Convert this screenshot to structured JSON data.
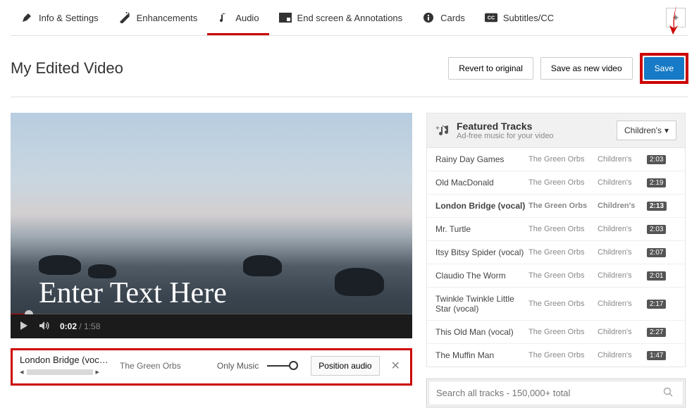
{
  "tabs": {
    "info": "Info & Settings",
    "enh": "Enhancements",
    "audio": "Audio",
    "endscreen": "End screen & Annotations",
    "cards": "Cards",
    "subs": "Subtitles/CC"
  },
  "header": {
    "title": "My Edited Video",
    "revert": "Revert to original",
    "save_new": "Save as new video",
    "save": "Save"
  },
  "video": {
    "overlay_text": "Enter Text Here",
    "time_current": "0:02",
    "time_total": "1:58"
  },
  "selected_track": {
    "title": "London Bridge (voc…",
    "artist": "The Green Orbs",
    "only_label": "Only Music",
    "position_btn": "Position audio"
  },
  "featured": {
    "title": "Featured Tracks",
    "sub": "Ad-free music for your video",
    "genre_selected": "Children's"
  },
  "tracks": [
    {
      "name": "Rainy Day Games",
      "artist": "The Green Orbs",
      "genre": "Children's",
      "dur": "2:03"
    },
    {
      "name": "Old MacDonald",
      "artist": "The Green Orbs",
      "genre": "Children's",
      "dur": "2:19"
    },
    {
      "name": "London Bridge (vocal)",
      "artist": "The Green Orbs",
      "genre": "Children's",
      "dur": "2:13"
    },
    {
      "name": "Mr. Turtle",
      "artist": "The Green Orbs",
      "genre": "Children's",
      "dur": "2:03"
    },
    {
      "name": "Itsy Bitsy Spider (vocal)",
      "artist": "The Green Orbs",
      "genre": "Children's",
      "dur": "2:07"
    },
    {
      "name": "Claudio The Worm",
      "artist": "The Green Orbs",
      "genre": "Children's",
      "dur": "2:01"
    },
    {
      "name": "Twinkle Twinkle Little Star (vocal)",
      "artist": "The Green Orbs",
      "genre": "Children's",
      "dur": "2:17"
    },
    {
      "name": "This Old Man (vocal)",
      "artist": "The Green Orbs",
      "genre": "Children's",
      "dur": "2:27"
    },
    {
      "name": "The Muffin Man",
      "artist": "The Green Orbs",
      "genre": "Children's",
      "dur": "1:47"
    }
  ],
  "search": {
    "placeholder": "Search all tracks - 150,000+ total"
  }
}
